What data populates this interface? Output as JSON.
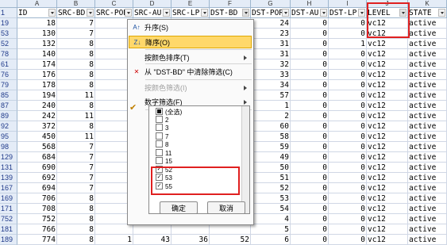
{
  "columns": [
    {
      "letter": "A",
      "header": "ID",
      "filter": false
    },
    {
      "letter": "B",
      "header": "SRC-BD",
      "filter": false
    },
    {
      "letter": "C",
      "header": "SRC-POR",
      "filter": false
    },
    {
      "letter": "D",
      "header": "SRC-AU",
      "filter": false
    },
    {
      "letter": "E",
      "header": "SRC-LP",
      "filter": false
    },
    {
      "letter": "F",
      "header": "DST-BD",
      "filter": true
    },
    {
      "letter": "G",
      "header": "DST-POR",
      "filter": false
    },
    {
      "letter": "H",
      "header": "DST-AU",
      "filter": false
    },
    {
      "letter": "I",
      "header": "DST-LP",
      "filter": false
    },
    {
      "letter": "J",
      "header": "LEVEL",
      "filter": true
    },
    {
      "letter": "K",
      "header": "STATE",
      "filter": false
    }
  ],
  "header_row_number": "1",
  "rows": [
    {
      "n": "19",
      "a": "18",
      "b": "7",
      "g": "24",
      "h": "0",
      "i": "0",
      "j": "vc12",
      "k": "active"
    },
    {
      "n": "53",
      "a": "130",
      "b": "7",
      "g": "23",
      "h": "0",
      "i": "0",
      "j": "vc12",
      "k": "active"
    },
    {
      "n": "52",
      "a": "132",
      "b": "8",
      "g": "31",
      "h": "0",
      "i": "1",
      "j": "vc12",
      "k": "active"
    },
    {
      "n": "78",
      "a": "140",
      "b": "8",
      "g": "31",
      "h": "0",
      "i": "0",
      "j": "vc12",
      "k": "active"
    },
    {
      "n": "61",
      "a": "174",
      "b": "8",
      "g": "32",
      "h": "0",
      "i": "0",
      "j": "vc12",
      "k": "active"
    },
    {
      "n": "76",
      "a": "176",
      "b": "8",
      "g": "33",
      "h": "0",
      "i": "0",
      "j": "vc12",
      "k": "active"
    },
    {
      "n": "79",
      "a": "178",
      "b": "8",
      "g": "34",
      "h": "0",
      "i": "0",
      "j": "vc12",
      "k": "active"
    },
    {
      "n": "85",
      "a": "194",
      "b": "11",
      "g": "57",
      "h": "0",
      "i": "0",
      "j": "vc12",
      "k": "active"
    },
    {
      "n": "87",
      "a": "240",
      "b": "8",
      "g": "1",
      "h": "0",
      "i": "0",
      "j": "vc12",
      "k": "active"
    },
    {
      "n": "89",
      "a": "242",
      "b": "11",
      "g": "2",
      "h": "0",
      "i": "0",
      "j": "vc12",
      "k": "active"
    },
    {
      "n": "92",
      "a": "372",
      "b": "8",
      "g": "60",
      "h": "0",
      "i": "0",
      "j": "vc12",
      "k": "active"
    },
    {
      "n": "95",
      "a": "450",
      "b": "11",
      "g": "58",
      "h": "0",
      "i": "0",
      "j": "vc12",
      "k": "active"
    },
    {
      "n": "98",
      "a": "568",
      "b": "7",
      "g": "59",
      "h": "0",
      "i": "0",
      "j": "vc12",
      "k": "active"
    },
    {
      "n": "129",
      "a": "684",
      "b": "7",
      "g": "49",
      "h": "0",
      "i": "0",
      "j": "vc12",
      "k": "active"
    },
    {
      "n": "131",
      "a": "690",
      "b": "7",
      "g": "50",
      "h": "0",
      "i": "0",
      "j": "vc12",
      "k": "active"
    },
    {
      "n": "139",
      "a": "692",
      "b": "7",
      "g": "51",
      "h": "0",
      "i": "0",
      "j": "vc12",
      "k": "active"
    },
    {
      "n": "167",
      "a": "694",
      "b": "7",
      "g": "52",
      "h": "0",
      "i": "0",
      "j": "vc12",
      "k": "active"
    },
    {
      "n": "169",
      "a": "706",
      "b": "8",
      "g": "53",
      "h": "0",
      "i": "0",
      "j": "vc12",
      "k": "active"
    },
    {
      "n": "171",
      "a": "708",
      "b": "8",
      "g": "54",
      "h": "0",
      "i": "0",
      "j": "vc12",
      "k": "active"
    },
    {
      "n": "752",
      "a": "752",
      "b": "8",
      "g": "4",
      "h": "0",
      "i": "0",
      "j": "vc12",
      "k": "active"
    },
    {
      "n": "181",
      "a": "766",
      "b": "8",
      "g": "5",
      "h": "0",
      "i": "0",
      "j": "vc12",
      "k": "active"
    },
    {
      "n": "189",
      "a": "774",
      "b": "8",
      "c": "1",
      "d": "43",
      "e": "36",
      "f": "52",
      "g": "6",
      "h": "0",
      "i": "0",
      "j": "vc12",
      "k": "active"
    }
  ],
  "menu": {
    "items": [
      {
        "label": "升序(S)",
        "icon": "sort-ascending-icon"
      },
      {
        "label": "降序(O)",
        "icon": "sort-descending-icon",
        "highlight": true
      },
      {
        "label": "按颜色排序(T)",
        "arrow": true
      },
      {
        "label": "从 \"DST-BD\" 中清除筛选(C)",
        "icon": "clear-filter-icon"
      },
      {
        "label": "按颜色筛选(I)",
        "arrow": true,
        "disabled": true
      },
      {
        "label": "数字筛选(F)",
        "arrow": true
      }
    ],
    "list": [
      {
        "label": "(全选)",
        "checked": "partial"
      },
      {
        "label": "2",
        "checked": false
      },
      {
        "label": "3",
        "checked": false
      },
      {
        "label": "7",
        "checked": false
      },
      {
        "label": "8",
        "checked": false
      },
      {
        "label": "11",
        "checked": false
      },
      {
        "label": "15",
        "checked": false
      },
      {
        "label": "52",
        "checked": true
      },
      {
        "label": "53",
        "checked": true
      },
      {
        "label": "55",
        "checked": true
      }
    ],
    "ok_label": "确定",
    "cancel_label": "取消"
  },
  "colors": {
    "highlight_box": "#e02020",
    "header_bg": "#e4ecf7",
    "menu_highlight": "#ffd86a"
  }
}
